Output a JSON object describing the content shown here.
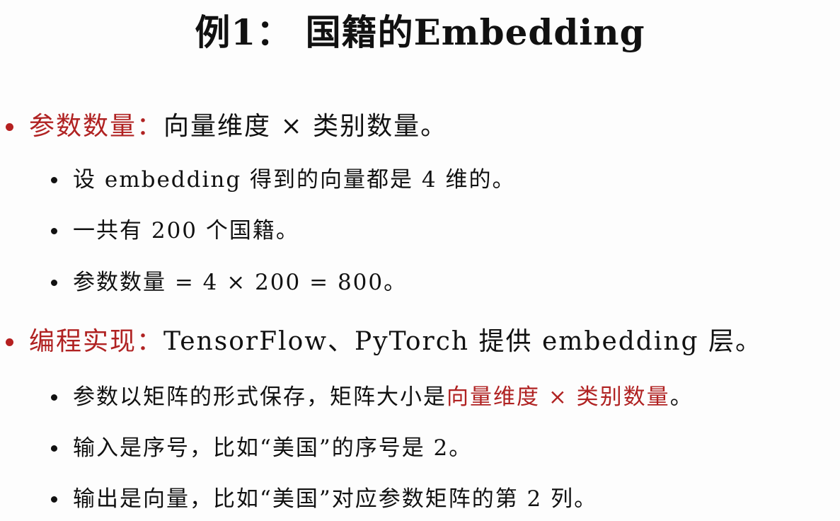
{
  "title": "例1： 国籍的Embedding",
  "sections": [
    {
      "heading": "参数数量：",
      "text": "向量维度 × 类别数量。",
      "items": [
        {
          "text": "设 embedding 得到的向量都是 4 维的。"
        },
        {
          "text": "一共有 200 个国籍。"
        },
        {
          "text": "参数数量 = 4 × 200 = 800。"
        }
      ]
    },
    {
      "heading": "编程实现：",
      "text": "TensorFlow、PyTorch 提供 embedding 层。",
      "items": [
        {
          "text": "参数以矩阵的形式保存，矩阵大小是",
          "highlight": "向量维度 × 类别数量",
          "suffix": "。"
        },
        {
          "text": "输入是序号，比如“美国”的序号是 2。"
        },
        {
          "text": "输出是向量，比如“美国”对应参数矩阵的第 2 列。"
        }
      ]
    }
  ],
  "colors": {
    "accent": "#b02222",
    "text": "#111111",
    "background": "#fdfdfd"
  }
}
